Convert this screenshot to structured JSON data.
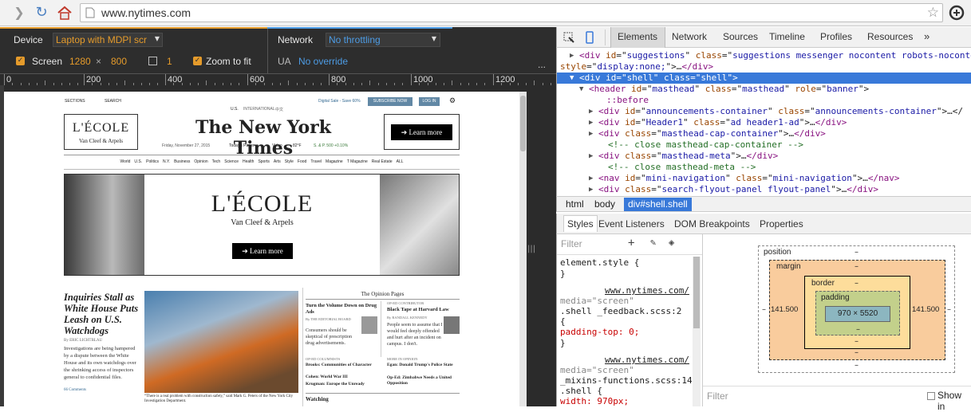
{
  "browser": {
    "url": "www.nytimes.com"
  },
  "device": {
    "device_label": "Device",
    "device_value": "Laptop with MDPI scr",
    "network_label": "Network",
    "network_value": "No throttling",
    "screen_label": "Screen",
    "width": "1280",
    "times": "×",
    "height": "800",
    "scale": "1",
    "zoom_label": "Zoom to fit",
    "ua_label": "UA",
    "ua_value": "No override",
    "more": "..."
  },
  "ruler": [
    "0",
    "200",
    "400",
    "600",
    "800",
    "1000",
    "1200"
  ],
  "devtools": {
    "tabs": [
      "Elements",
      "Network",
      "Sources",
      "Timeline",
      "Profiles",
      "Resources"
    ],
    "more": "»",
    "crumbs": [
      "html",
      "body",
      "div#shell.shell"
    ],
    "style_tabs": [
      "Styles",
      "Event Listeners",
      "DOM Breakpoints",
      "Properties"
    ],
    "filter_ph": "Filter",
    "filter2_ph": "Filter",
    "show_inherited": "Show in"
  },
  "dom": [
    {
      "tri": "▶",
      "parts": [
        [
          "tg",
          "<div "
        ],
        [
          "at",
          "id"
        ],
        [
          "tx",
          "=\""
        ],
        [
          "av",
          "suggestions"
        ],
        [
          "tx",
          "\" "
        ],
        [
          "at",
          "class"
        ],
        [
          "tx",
          "=\""
        ],
        [
          "av",
          "suggestions messenger nocontent robots-noconte"
        ]
      ]
    },
    {
      "tri": "",
      "parts": [
        [
          "at",
          "style"
        ],
        [
          "tx",
          "=\""
        ],
        [
          "av",
          "display:none;"
        ],
        [
          "tx",
          "\">…"
        ],
        [
          "tg",
          "</div>"
        ]
      ]
    },
    {
      "tri": "▼",
      "sel": true,
      "parts": [
        [
          "tg",
          "<div "
        ],
        [
          "at",
          "id"
        ],
        [
          "tx",
          "=\""
        ],
        [
          "av",
          "shell"
        ],
        [
          "tx",
          "\" "
        ],
        [
          "at",
          "class"
        ],
        [
          "tx",
          "=\""
        ],
        [
          "av",
          "shell"
        ],
        [
          "tx",
          "\">"
        ]
      ]
    },
    {
      "tri": "▼",
      "parts": [
        [
          "tg",
          "<header "
        ],
        [
          "at",
          "id"
        ],
        [
          "tx",
          "=\""
        ],
        [
          "av",
          "masthead"
        ],
        [
          "tx",
          "\" "
        ],
        [
          "at",
          "class"
        ],
        [
          "tx",
          "=\""
        ],
        [
          "av",
          "masthead"
        ],
        [
          "tx",
          "\" "
        ],
        [
          "at",
          "role"
        ],
        [
          "tx",
          "=\""
        ],
        [
          "av",
          "banner"
        ],
        [
          "tx",
          "\">"
        ]
      ]
    },
    {
      "tri": "",
      "parts": [
        [
          "tg",
          "::before"
        ]
      ]
    },
    {
      "tri": "▶",
      "parts": [
        [
          "tg",
          "<div "
        ],
        [
          "at",
          "id"
        ],
        [
          "tx",
          "=\""
        ],
        [
          "av",
          "announcements-container"
        ],
        [
          "tx",
          "\" "
        ],
        [
          "at",
          "class"
        ],
        [
          "tx",
          "=\""
        ],
        [
          "av",
          "announcements-container"
        ],
        [
          "tx",
          "\">…</"
        ]
      ]
    },
    {
      "tri": "▶",
      "parts": [
        [
          "tg",
          "<div "
        ],
        [
          "at",
          "id"
        ],
        [
          "tx",
          "=\""
        ],
        [
          "av",
          "Header1"
        ],
        [
          "tx",
          "\" "
        ],
        [
          "at",
          "class"
        ],
        [
          "tx",
          "=\""
        ],
        [
          "av",
          "ad header1-ad"
        ],
        [
          "tx",
          "\">…"
        ],
        [
          "tg",
          "</div>"
        ]
      ]
    },
    {
      "tri": "▶",
      "parts": [
        [
          "tg",
          "<div "
        ],
        [
          "at",
          "class"
        ],
        [
          "tx",
          "=\""
        ],
        [
          "av",
          "masthead-cap-container"
        ],
        [
          "tx",
          "\">…"
        ],
        [
          "tg",
          "</div>"
        ]
      ]
    },
    {
      "tri": "",
      "parts": [
        [
          "cm",
          "<!-- close masthead-cap-container -->"
        ]
      ]
    },
    {
      "tri": "▶",
      "parts": [
        [
          "tg",
          "<div "
        ],
        [
          "at",
          "class"
        ],
        [
          "tx",
          "=\""
        ],
        [
          "av",
          "masthead-meta"
        ],
        [
          "tx",
          "\">…"
        ],
        [
          "tg",
          "</div>"
        ]
      ]
    },
    {
      "tri": "",
      "parts": [
        [
          "cm",
          "<!-- close masthead-meta -->"
        ]
      ]
    },
    {
      "tri": "▶",
      "parts": [
        [
          "tg",
          "<nav "
        ],
        [
          "at",
          "id"
        ],
        [
          "tx",
          "=\""
        ],
        [
          "av",
          "mini-navigation"
        ],
        [
          "tx",
          "\" "
        ],
        [
          "at",
          "class"
        ],
        [
          "tx",
          "=\""
        ],
        [
          "av",
          "mini-navigation"
        ],
        [
          "tx",
          "\">…"
        ],
        [
          "tg",
          "</nav>"
        ]
      ]
    },
    {
      "tri": "▶",
      "parts": [
        [
          "tg",
          "<div "
        ],
        [
          "at",
          "class"
        ],
        [
          "tx",
          "=\""
        ],
        [
          "av",
          "search-flyout-panel flyout-panel"
        ],
        [
          "tx",
          "\">…"
        ],
        [
          "tg",
          "</div>"
        ]
      ]
    }
  ],
  "styles": [
    {
      "t": "element.style {",
      "c": "#222"
    },
    {
      "t": "}",
      "c": "#222"
    },
    {
      "t": "www.nytimes.com/",
      "c": "#222",
      "r": true
    },
    {
      "t": "media=\"screen\"",
      "c": "#888"
    },
    {
      "t": ".shell  _feedback.scss:2",
      "c": "#222"
    },
    {
      "t": "{",
      "c": "#222"
    },
    {
      "t": "  padding-top: 0;",
      "c": "#c80000"
    },
    {
      "t": "}",
      "c": "#222"
    },
    {
      "t": "www.nytimes.com/",
      "c": "#222",
      "r": true
    },
    {
      "t": "media=\"screen\"",
      "c": "#888"
    },
    {
      "t": "_mixins-functions.scss:14",
      "c": "#222"
    },
    {
      "t": ".shell {",
      "c": "#222"
    },
    {
      "t": "  width: 970px;",
      "c": "#c80000"
    }
  ],
  "box": {
    "position": "position",
    "margin": "margin",
    "border": "border",
    "padding": "padding",
    "content": "970 × 5520",
    "left": "141.500",
    "right": "141.500",
    "dash": "–"
  },
  "nyt": {
    "sections": "SECTIONS",
    "search": "SEARCH",
    "us": "U.S.",
    "intl": "INTERNATIONAL",
    "zh": "中文",
    "digital": "Digital Sale - Save 60%",
    "subscribe": "SUBSCRIBE NOW",
    "login": "LOG IN",
    "ad_brand": "L'ÉCOLE",
    "ad_sub": "Van Cleef & Arpels",
    "ad_learn": "➔ Learn more",
    "logo": "The New York Times",
    "date": "Friday, November 27, 2015",
    "todays": "Today's Paper",
    "video": "Video",
    "weather": "82°F",
    "market": "S. & P. 500 +0.10%",
    "nav": [
      "World",
      "U.S.",
      "Politics",
      "N.Y.",
      "Business",
      "Opinion",
      "Tech",
      "Science",
      "Health",
      "Sports",
      "Arts",
      "Style",
      "Food",
      "Travel",
      "Magazine",
      "T Magazine",
      "Real Estate",
      "ALL"
    ],
    "headline": "Inquiries Stall as White House Puts Leash on U.S. Watchdogs",
    "byline": "By ERIC LICHTBLAU",
    "summary": "Investigations are being hampered by a dispute between the White House and its own watchdogs over the shrinking access of inspectors general to confidential files.",
    "comments": "66 Comments",
    "caption": "“There is a real problem with construction safety,” said Mark G. Peters of the New York City Investigation Department.",
    "opinion_title": "The Opinion Pages",
    "op1": "Turn the Volume Down on Drug Ads",
    "op1_by": "By THE EDITORIAL BOARD",
    "op1_sum": "Consumers should be skeptical of prescription drug advertisements.",
    "op2_kicker": "OP-ED CONTRIBUTOR",
    "op2": "Black Tape at Harvard Law",
    "op2_by": "By RANDALL KENNEDY",
    "op2_sum": "People seem to assume that I would feel deeply offended and hurt after an incident on campus. I don't.",
    "op_col": "OP-ED COLUMNISTS",
    "op3": "Brooks: Communities of Character",
    "op4": "Cohen: World War III",
    "op5": "Krugman: Europe the Unready",
    "op_more": "MORE IN OPINION",
    "op6": "Egan: Donald Trump's Police State",
    "op7": "Op-Ed: Zimbabwe Needs a United Opposition",
    "watching": "Watching"
  }
}
